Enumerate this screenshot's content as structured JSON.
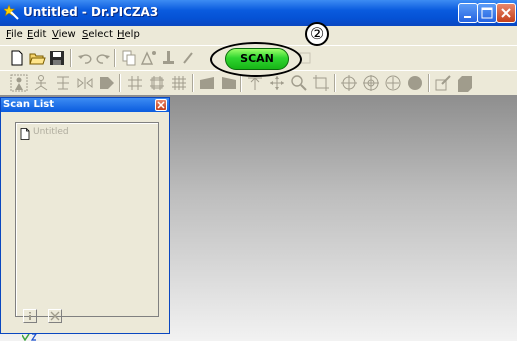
{
  "window": {
    "title": "Untitled - Dr.PICZA3",
    "app_icon": "star-wand-icon",
    "controls": [
      "minimize-icon",
      "maximize-icon",
      "close-icon"
    ]
  },
  "menu": {
    "items": [
      {
        "id": "file",
        "accel": "F",
        "rest": "ile"
      },
      {
        "id": "edit",
        "accel": "E",
        "rest": "dit"
      },
      {
        "id": "view",
        "accel": "V",
        "rest": "iew"
      },
      {
        "id": "select",
        "accel": "S",
        "rest": "elect"
      },
      {
        "id": "help",
        "accel": "H",
        "rest": "elp"
      }
    ]
  },
  "toolbar": {
    "scan_label": "SCAN",
    "callout_number": "②",
    "row1_icons": [
      "new-icon",
      "open-icon",
      "save-icon",
      "undo-icon",
      "redo-icon",
      "copy-icon",
      "image-adjust-icon",
      "tool-icon",
      "tool-icon"
    ],
    "row2_icons": [
      "select-person-icon",
      "person-icon",
      "align-icon",
      "flip-icon",
      "shape-icon",
      "grid-icon",
      "grid-icon",
      "grid-icon",
      "shape-icon",
      "shape-icon",
      "move-icon",
      "move-icon",
      "zoom-icon",
      "crop-icon",
      "target-icon",
      "target-icon",
      "target-icon",
      "circle-icon",
      "edit-icon",
      "shape-icon"
    ]
  },
  "scan_list": {
    "title": "Scan List",
    "items": [
      "Untitled"
    ],
    "bottom_buttons": [
      "info-icon",
      "delete-icon"
    ]
  },
  "colors": {
    "title_bar": "#0a5bde",
    "scan_button": "#2fd62f",
    "window_face": "#ece9d8"
  }
}
